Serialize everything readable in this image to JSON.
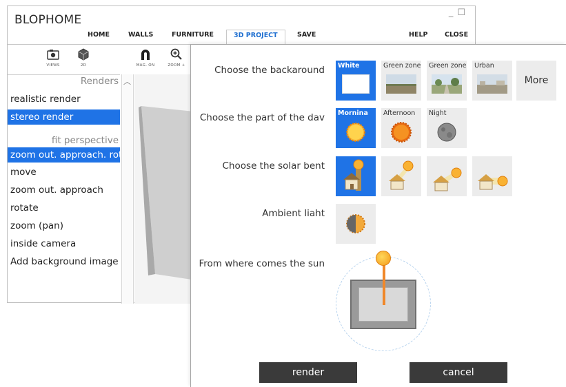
{
  "app": {
    "title": "BLOPHOME",
    "menu": [
      "HOME",
      "WALLS",
      "FURNITURE",
      "3D PROJECT",
      "SAVE",
      "HELP",
      "CLOSE"
    ],
    "toolbar": [
      {
        "icon": "camera-icon",
        "label": "VIEWS"
      },
      {
        "icon": "cube-icon",
        "label": "2D"
      },
      {
        "icon": "magnet-icon",
        "label": "MAG. ON"
      },
      {
        "icon": "zoom-in-icon",
        "label": "ZOOM +"
      }
    ],
    "sidebar": {
      "heading_renders": "Renders",
      "heading_fit": "fit perspective",
      "items": [
        "realistic render",
        "stereo render",
        "zoom out. approach. rota",
        "move",
        "zoom out. approach",
        "rotate",
        "zoom (pan)",
        "inside camera",
        "Add background image"
      ]
    }
  },
  "dialog": {
    "background": {
      "label": "Choose the backaround",
      "options": [
        "White",
        "Green zone",
        "Green zone",
        "Urban"
      ],
      "more": "More"
    },
    "day": {
      "label": "Choose the part of the dav",
      "options": [
        "Mornina",
        "Afternoon",
        "Night"
      ]
    },
    "solar": {
      "label": "Choose the solar bent"
    },
    "ambient": {
      "label": "Ambient liaht"
    },
    "sun": {
      "label": "From where comes the sun"
    },
    "render_button": "render",
    "cancel_button": "cancel"
  },
  "colors": {
    "accent": "#1f73e6",
    "button": "#3a3a3a",
    "sun": "#f39a1a"
  }
}
